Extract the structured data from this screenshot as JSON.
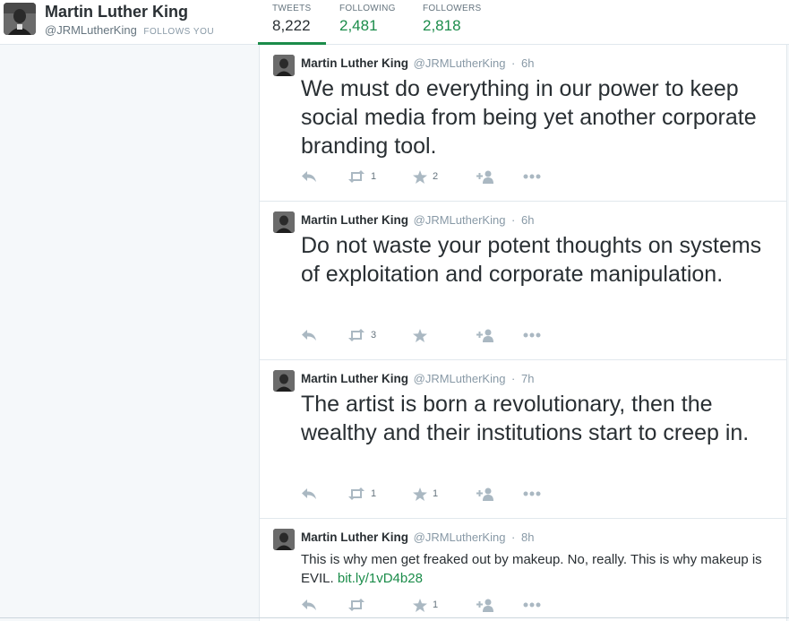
{
  "profile": {
    "name": "Martin Luther King",
    "handle": "@JRMLutherKing",
    "follows_you": "FOLLOWS YOU",
    "avatar_icon": "portrait-avatar"
  },
  "stats": [
    {
      "label": "TWEETS",
      "value": "8,222",
      "active": true
    },
    {
      "label": "FOLLOWING",
      "value": "2,481",
      "active": false
    },
    {
      "label": "FOLLOWERS",
      "value": "2,818",
      "active": false
    }
  ],
  "colors": {
    "accent": "#1b8c4a",
    "text": "#292f33",
    "muted": "#8899a6",
    "border": "#e1e8ed"
  },
  "tweets": [
    {
      "name": "Martin Luther King",
      "handle": "@JRMLutherKing",
      "dot": "·",
      "time": "6h",
      "text": "We must do everything in our power to keep social media from being yet another corporate branding tool.",
      "retweets": "1",
      "favorites": "2"
    },
    {
      "name": "Martin Luther King",
      "handle": "@JRMLutherKing",
      "dot": "·",
      "time": "6h",
      "text": "Do not waste your potent thoughts on systems of exploitation and corporate manipulation.",
      "retweets": "3",
      "favorites": ""
    },
    {
      "name": "Martin Luther King",
      "handle": "@JRMLutherKing",
      "dot": "·",
      "time": "7h",
      "text": "The artist is born a revolutionary, then the wealthy and their institutions start to creep in.",
      "retweets": "1",
      "favorites": "1"
    },
    {
      "name": "Martin Luther King",
      "handle": "@JRMLutherKing",
      "dot": "·",
      "time": "8h",
      "text": "This is why men get freaked out by makeup. No, really. This is why makeup is EVIL.",
      "link": "bit.ly/1vD4b28",
      "retweets": "",
      "favorites": "1"
    }
  ]
}
